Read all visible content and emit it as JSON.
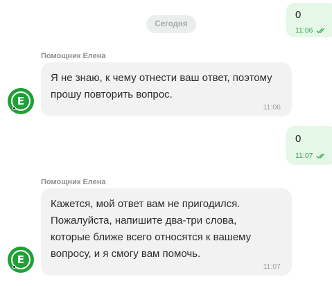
{
  "date_divider": "Сегодня",
  "messages": [
    {
      "direction": "out",
      "text": "0",
      "time": "11:06"
    },
    {
      "direction": "in",
      "sender": "Помощник Елена",
      "avatar_letter": "Е",
      "text": "Я не знаю, к чему отнести ваш ответ, поэтому прошу повторить вопрос.",
      "time": "11:06"
    },
    {
      "direction": "out",
      "text": "0",
      "time": "11:07"
    },
    {
      "direction": "in",
      "sender": "Помощник Елена",
      "avatar_letter": "Е",
      "text": "Кажется, мой ответ вам не пригодился. Пожалуйста, напишите два-три слова, которые ближе всего относятся к вашему вопросу, и я смогу вам помочь.",
      "time": "11:07"
    }
  ],
  "colors": {
    "outgoing_bubble": "#e5f7e7",
    "incoming_bubble": "#f2f2f2",
    "accent_green": "#21a038",
    "read_check": "#2aa84a"
  },
  "icons": {
    "read_status": "double-check-icon",
    "avatar": "assistant-avatar-icon"
  }
}
